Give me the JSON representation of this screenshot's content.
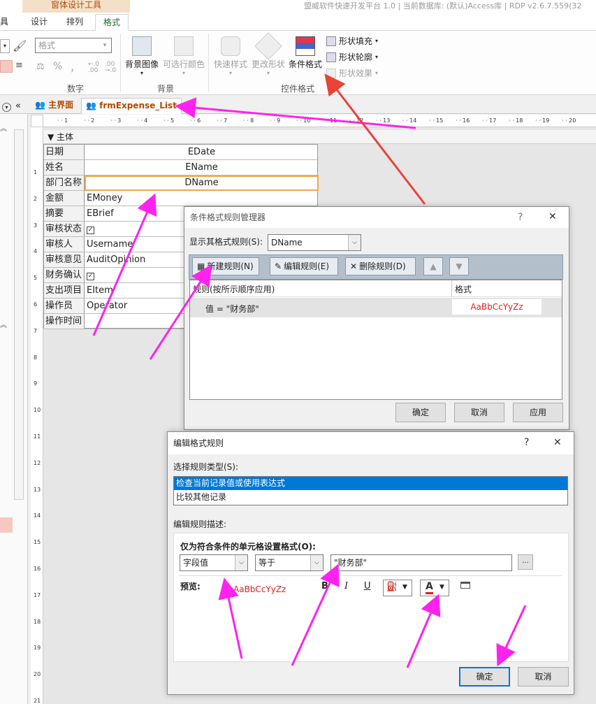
{
  "app": {
    "context_group": "窗体设计工具",
    "title_bar": "盟威软件快速开发平台 1.0 | 当前数据库: (默认)Access库 | RDP v2.6.7.559(32",
    "left_cut_tab": "具"
  },
  "ribbon": {
    "tabs": [
      "设计",
      "排列",
      "格式"
    ],
    "active_tab": "格式",
    "number_group": {
      "label": "数字",
      "format_combo": "格式",
      "percent": "%",
      "comma": "，"
    },
    "background_group": {
      "label": "背景",
      "bg_image": "背景图像",
      "alt_color": "可选行颜色"
    },
    "control_format_group": {
      "label": "控件格式",
      "quick_style": "快速样式",
      "change_shape": "更改形状",
      "conditional_format": "条件格式",
      "shape_fill": "形状填充",
      "shape_outline": "形状轮廓",
      "shape_effects": "形状效果"
    }
  },
  "doc_tabs": [
    "主界面",
    "frmExpense_List"
  ],
  "design": {
    "section": "主体",
    "ruler_top": [
      "1",
      "2",
      "3",
      "4",
      "5",
      "6",
      "7",
      "8",
      "9",
      "10",
      "11",
      "12",
      "13",
      "14",
      "15",
      "16",
      "17",
      "18",
      "19",
      "20"
    ],
    "ruler_left": [
      "1",
      "2",
      "3",
      "4",
      "5",
      "6",
      "7",
      "8",
      "9",
      "10",
      "11",
      "12",
      "13",
      "14",
      "15",
      "16",
      "17",
      "18",
      "19",
      "20",
      "21"
    ],
    "rows": [
      {
        "label": "日期",
        "value": "EDate",
        "centered": true
      },
      {
        "label": "姓名",
        "value": "EName",
        "centered": true
      },
      {
        "label": "部门名称",
        "value": "DName",
        "centered": true
      },
      {
        "label": "金额",
        "value": "EMoney",
        "centered": false
      },
      {
        "label": "摘要",
        "value": "EBrief",
        "centered": false
      },
      {
        "label": "审核状态",
        "value": "☑",
        "centered": false
      },
      {
        "label": "审核人",
        "value": "Username",
        "centered": false
      },
      {
        "label": "审核意见",
        "value": "AuditOpinion",
        "centered": false
      },
      {
        "label": "财务确认",
        "value": "☑",
        "centered": false
      },
      {
        "label": "支出项目",
        "value": "EItem",
        "centered": false
      },
      {
        "label": "操作员",
        "value": "Operator",
        "centered": false
      },
      {
        "label": "操作时间",
        "value": "",
        "centered": false
      }
    ]
  },
  "rules_manager": {
    "title": "条件格式规则管理器",
    "help": "?",
    "close": "✕",
    "show_rules_label": "显示其格式规则(S):",
    "show_rules_value": "DName",
    "new_rule": "新建规则(N)",
    "edit_rule": "编辑规则(E)",
    "delete_rule": "删除规则(D)",
    "col_rule": "规则(按所示顺序应用)",
    "col_format": "格式",
    "rule_text": "值 = \"财务部\"",
    "rule_preview": "AaBbCcYyZz",
    "ok": "确定",
    "cancel": "取消",
    "apply": "应用"
  },
  "edit_rule": {
    "title": "编辑格式规则",
    "help": "?",
    "close": "✕",
    "select_type_label": "选择规则类型(S):",
    "types": [
      "检查当前记录值或使用表达式",
      "比较其他记录"
    ],
    "selected_type_index": 0,
    "desc_label": "编辑规则描述:",
    "only_format_label": "仅为符合条件的单元格设置格式(O):",
    "field_combo": "字段值",
    "operator_combo": "等于",
    "value_input": "\"财务部\"",
    "ellipsis": "...",
    "preview_label": "预览:",
    "preview_sample": "AaBbCcYyZz",
    "bold": "B",
    "italic": "I",
    "underline": "U",
    "font_color_letter": "A",
    "ok": "确定",
    "cancel": "取消"
  },
  "colors": {
    "accent_orange": "#b34a00",
    "preview_red": "#e02020",
    "selection_blue": "#0078d7",
    "annotation_magenta": "#ff22ee",
    "annotation_red": "#e8443a"
  }
}
